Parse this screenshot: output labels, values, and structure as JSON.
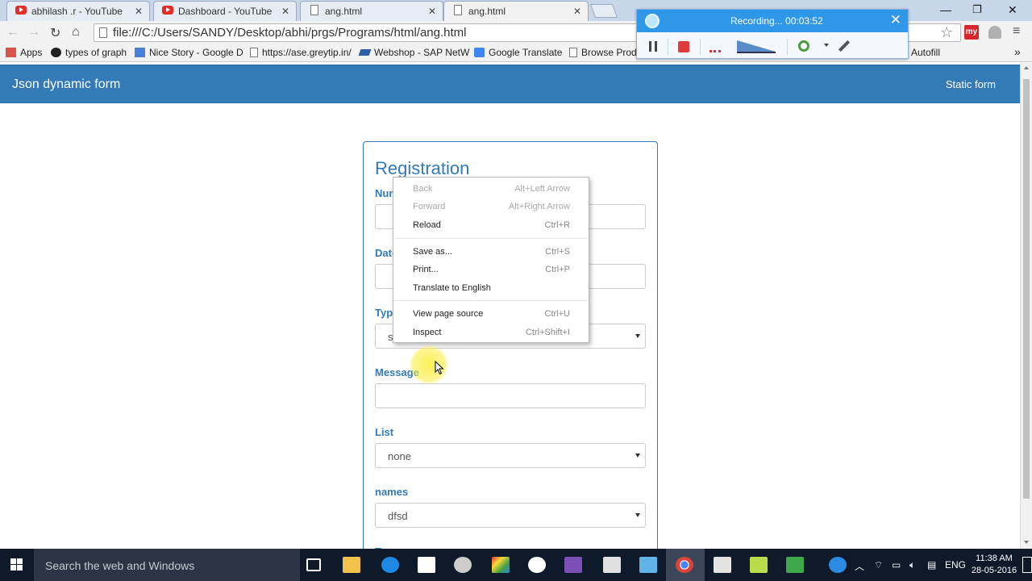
{
  "browser": {
    "tabs": [
      {
        "title": "abhilash .r - YouTube",
        "icon": "youtube-icon"
      },
      {
        "title": "Dashboard - YouTube",
        "icon": "youtube-icon"
      },
      {
        "title": "ang.html",
        "icon": "document-icon"
      },
      {
        "title": "ang.html",
        "icon": "document-icon",
        "active": true
      }
    ],
    "url": "file:///C:/Users/SANDY/Desktop/abhi/prgs/Programs/html/ang.html",
    "ext_my_label": "my",
    "bookmarks": [
      {
        "label": "Apps"
      },
      {
        "label": "types of graph"
      },
      {
        "label": "Nice Story - Google D"
      },
      {
        "label": "https://ase.greytip.in/"
      },
      {
        "label": "Webshop - SAP NetW"
      },
      {
        "label": "Google Translate"
      },
      {
        "label": "Browse Produ"
      },
      {
        "label": "Autofill"
      }
    ]
  },
  "page": {
    "brand": "Json dynamic form",
    "nav_link": "Static form",
    "form": {
      "title": "Registration",
      "fields": [
        {
          "label": "Number",
          "value": ""
        },
        {
          "label": "Date",
          "value": ""
        },
        {
          "label": "Type",
          "value": "s"
        },
        {
          "label": "Message",
          "value": ""
        },
        {
          "label": "List",
          "value": "none"
        },
        {
          "label": "names",
          "value": "dfsd"
        },
        {
          "label": "Type",
          "value": ""
        }
      ]
    }
  },
  "context_menu": {
    "items": [
      {
        "label": "Back",
        "shortcut": "Alt+Left Arrow",
        "disabled": true
      },
      {
        "label": "Forward",
        "shortcut": "Alt+Right Arrow",
        "disabled": true
      },
      {
        "label": "Reload",
        "shortcut": "Ctrl+R"
      },
      {
        "label": "Save as...",
        "shortcut": "Ctrl+S"
      },
      {
        "label": "Print...",
        "shortcut": "Ctrl+P"
      },
      {
        "label": "Translate to English",
        "shortcut": ""
      },
      {
        "label": "View page source",
        "shortcut": "Ctrl+U"
      },
      {
        "label": "Inspect",
        "shortcut": "Ctrl+Shift+I"
      }
    ]
  },
  "recorder": {
    "title": "Recording... 00:03:52"
  },
  "taskbar": {
    "search_placeholder": "Search the web and Windows",
    "language": "ENG",
    "time": "11:38 AM",
    "date": "28-05-2016"
  },
  "colors": {
    "brand_primary": "#337ab7",
    "recorder_header": "#2f97e8",
    "taskbar": "#0e1a2a"
  }
}
